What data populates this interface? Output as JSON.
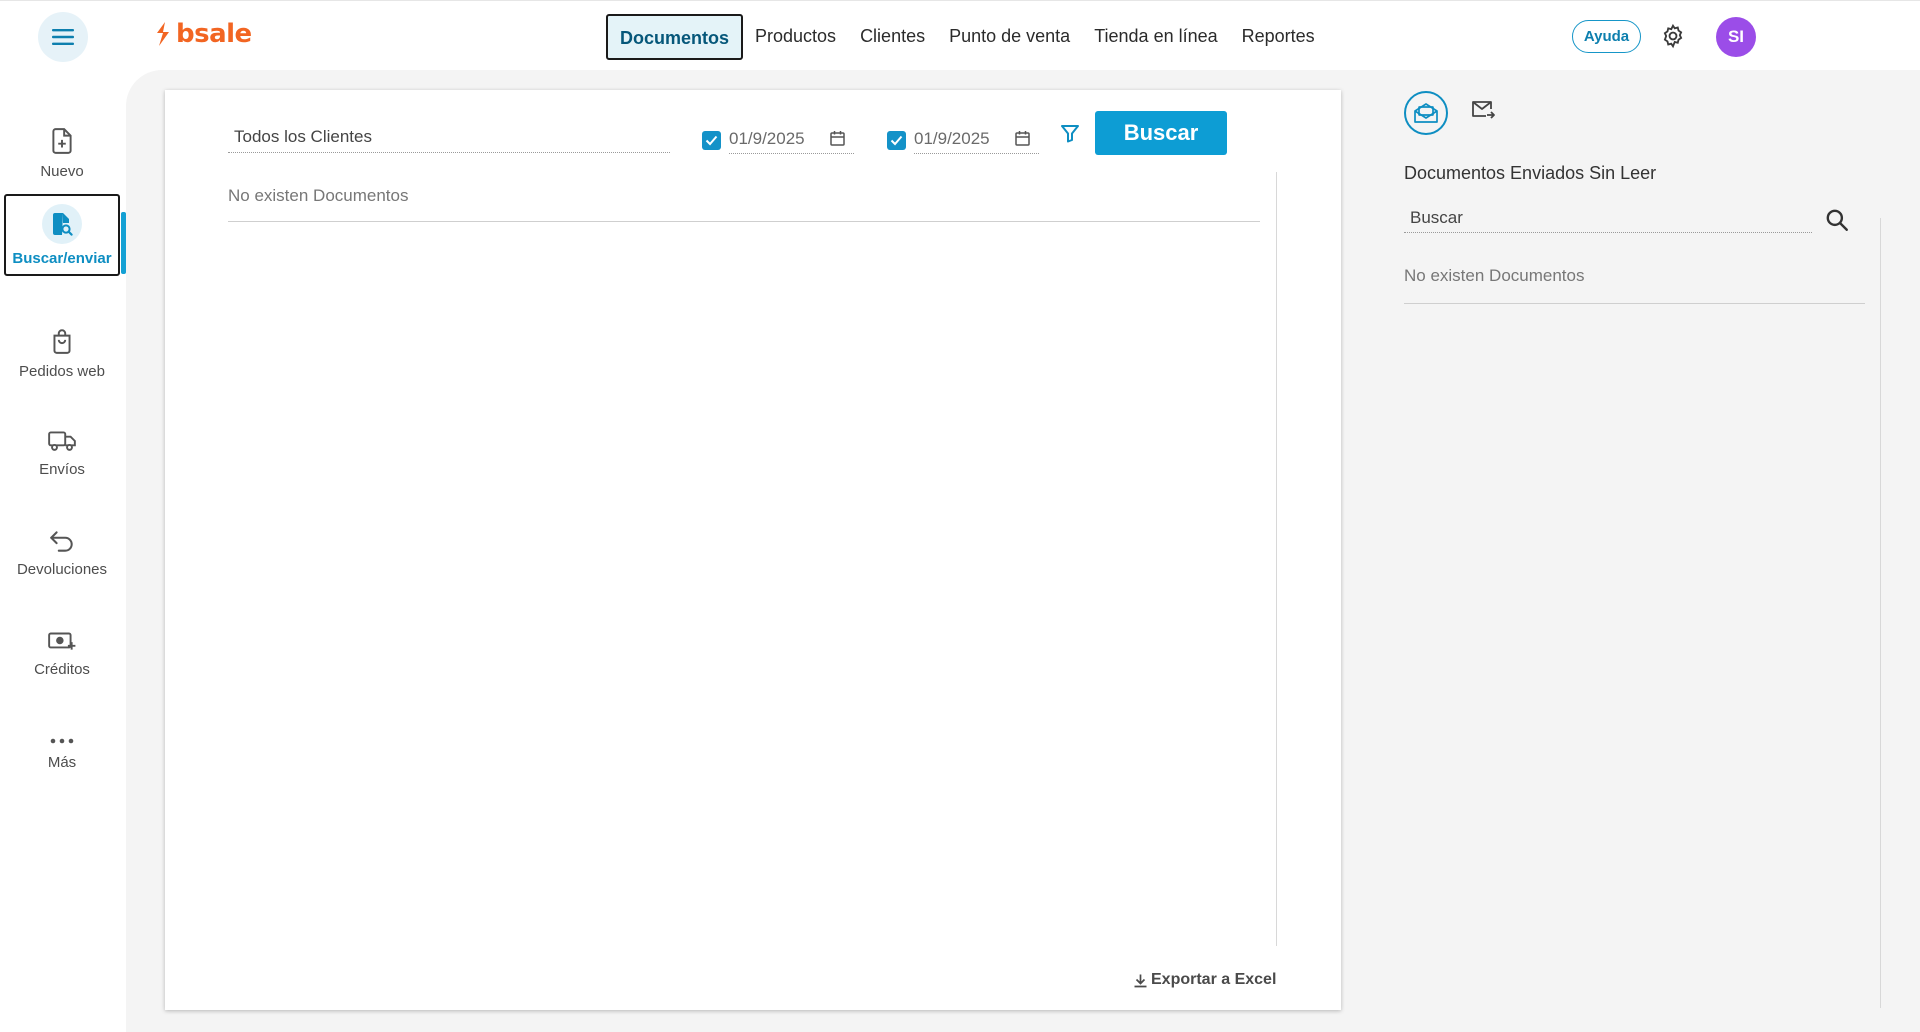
{
  "header": {
    "brand": "bsale",
    "nav": [
      "Documentos",
      "Productos",
      "Clientes",
      "Punto de venta",
      "Tienda en línea",
      "Reportes"
    ],
    "help_label": "Ayuda",
    "avatar_initials": "SI"
  },
  "sidebar": {
    "items": [
      {
        "label": "Nuevo",
        "icon": "new-document-icon"
      },
      {
        "label": "Buscar/enviar",
        "icon": "search-document-icon"
      },
      {
        "label": "Pedidos web",
        "icon": "shopping-bag-icon"
      },
      {
        "label": "Envíos",
        "icon": "truck-icon"
      },
      {
        "label": "Devoluciones",
        "icon": "return-arrow-icon"
      },
      {
        "label": "Créditos",
        "icon": "money-credit-icon"
      },
      {
        "label": "Más",
        "icon": "more-dots-icon"
      }
    ]
  },
  "main": {
    "client_filter": "Todos los Clientes",
    "date_from": "01/9/2025",
    "date_to": "01/9/2025",
    "search_label": "Buscar",
    "empty_message": "No existen Documentos",
    "export_label": "Exportar a Excel"
  },
  "right_panel": {
    "title": "Documentos Enviados Sin Leer",
    "search_placeholder": "Buscar",
    "empty_message": "No existen Documentos"
  },
  "colors": {
    "accent": "#0d9dd4",
    "brand": "#f26522",
    "avatar": "#9b4de8"
  }
}
